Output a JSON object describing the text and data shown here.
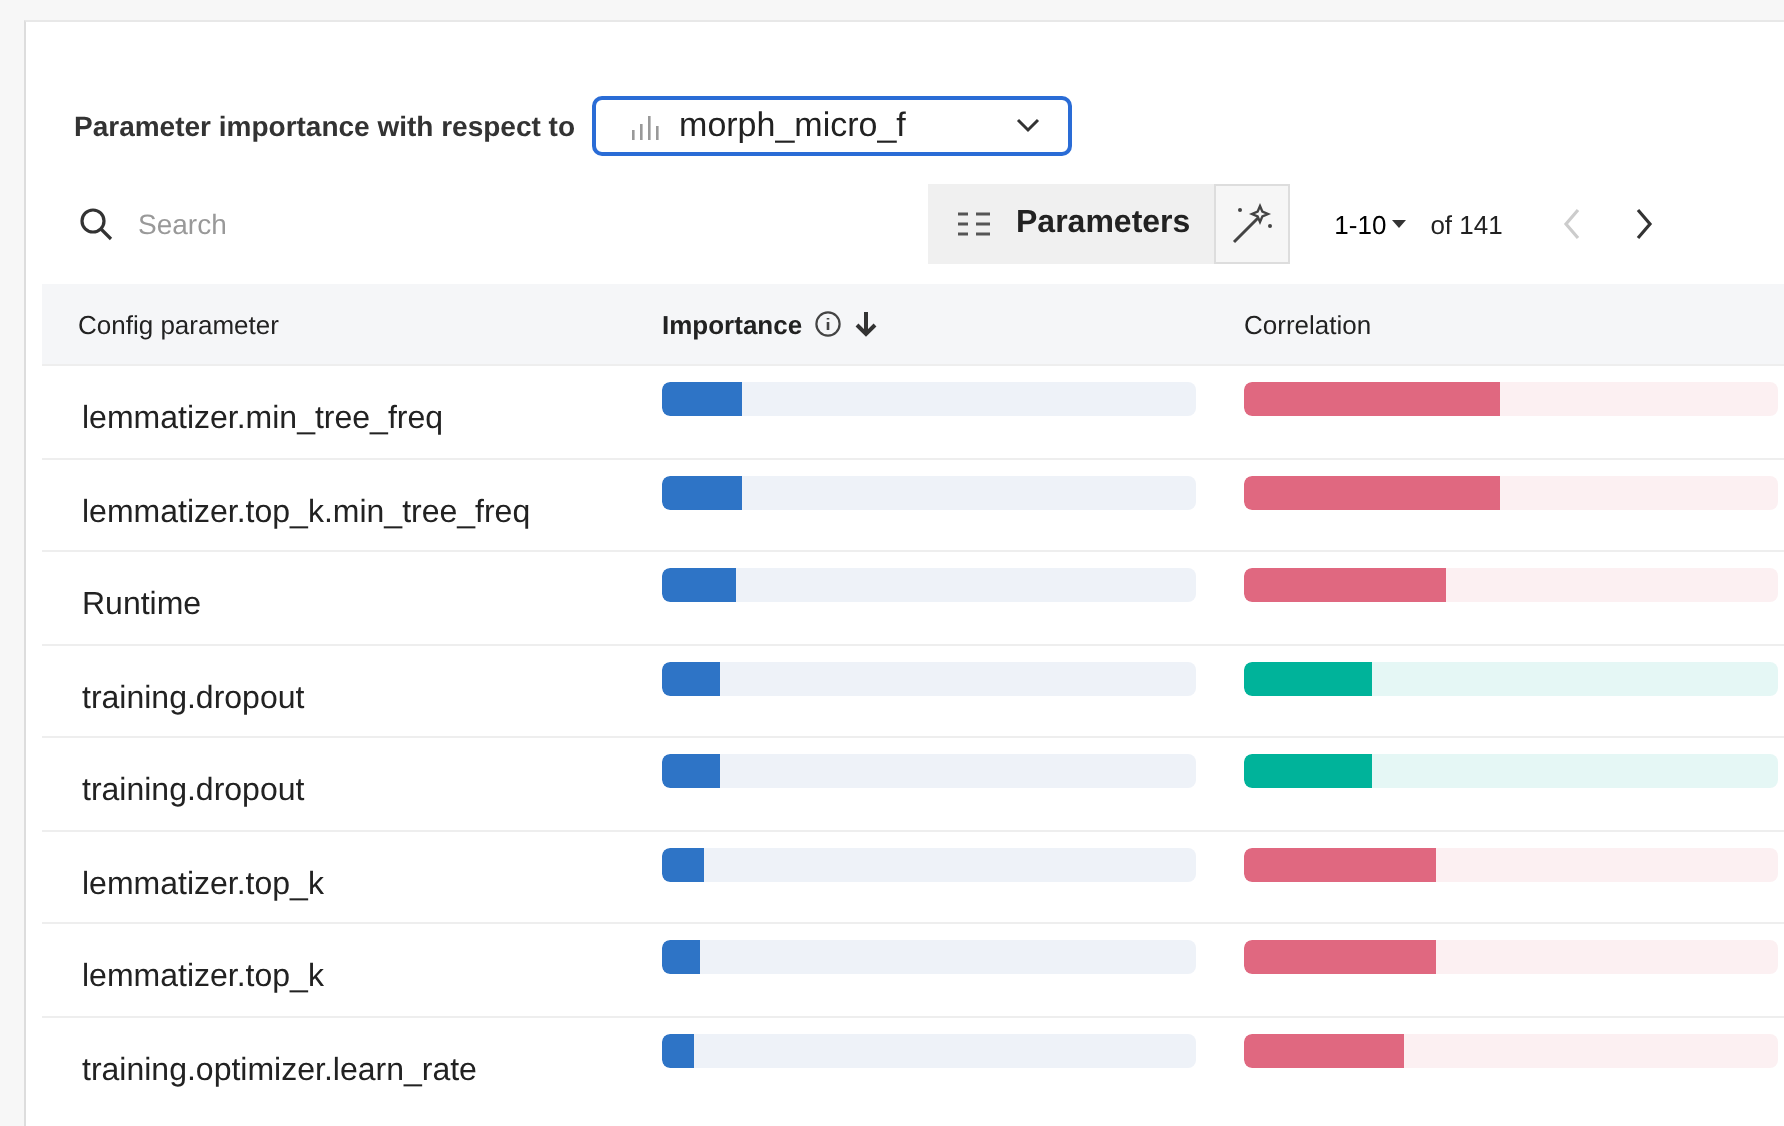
{
  "header": {
    "label": "Parameter importance with respect to",
    "metric": {
      "value": "morph_micro_f"
    }
  },
  "toolbar": {
    "search": {
      "placeholder": "Search"
    },
    "parameters_button": {
      "label": "Parameters"
    },
    "page_size": "1-10",
    "page_total": "of 141"
  },
  "table": {
    "columns": [
      "Config parameter",
      "Importance",
      "Correlation"
    ],
    "rows": [
      {
        "name": "lemmatizer.min_tree_freq",
        "importance": {
          "level": 0.15
        },
        "correlation": {
          "level": 0.48,
          "color": "#e06880"
        }
      },
      {
        "name": "lemmatizer.top_k.min_tree_freq",
        "importance": {
          "level": 0.15
        },
        "correlation": {
          "level": 0.48,
          "color": "#e06880"
        }
      },
      {
        "name": "Runtime",
        "importance": {
          "level": 0.14
        },
        "correlation": {
          "level": 0.38,
          "color": "#e06880"
        }
      },
      {
        "name": "training.dropout",
        "importance": {
          "level": 0.11
        },
        "correlation": {
          "level": 0.24,
          "color": "#00b39a"
        }
      },
      {
        "name": "training.dropout",
        "importance": {
          "level": 0.11
        },
        "correlation": {
          "level": 0.24,
          "color": "#00b39a"
        }
      },
      {
        "name": "lemmatizer.top_k",
        "importance": {
          "level": 0.08
        },
        "correlation": {
          "level": 0.36,
          "color": "#e06880"
        }
      },
      {
        "name": "lemmatizer.top_k",
        "importance": {
          "level": 0.07
        },
        "correlation": {
          "level": 0.36,
          "color": "#e06880"
        }
      },
      {
        "name": "training.optimizer.learn_rate",
        "importance": {
          "level": 0.06
        },
        "correlation": {
          "level": 0.3,
          "color": "#e06880"
        }
      }
    ]
  }
}
